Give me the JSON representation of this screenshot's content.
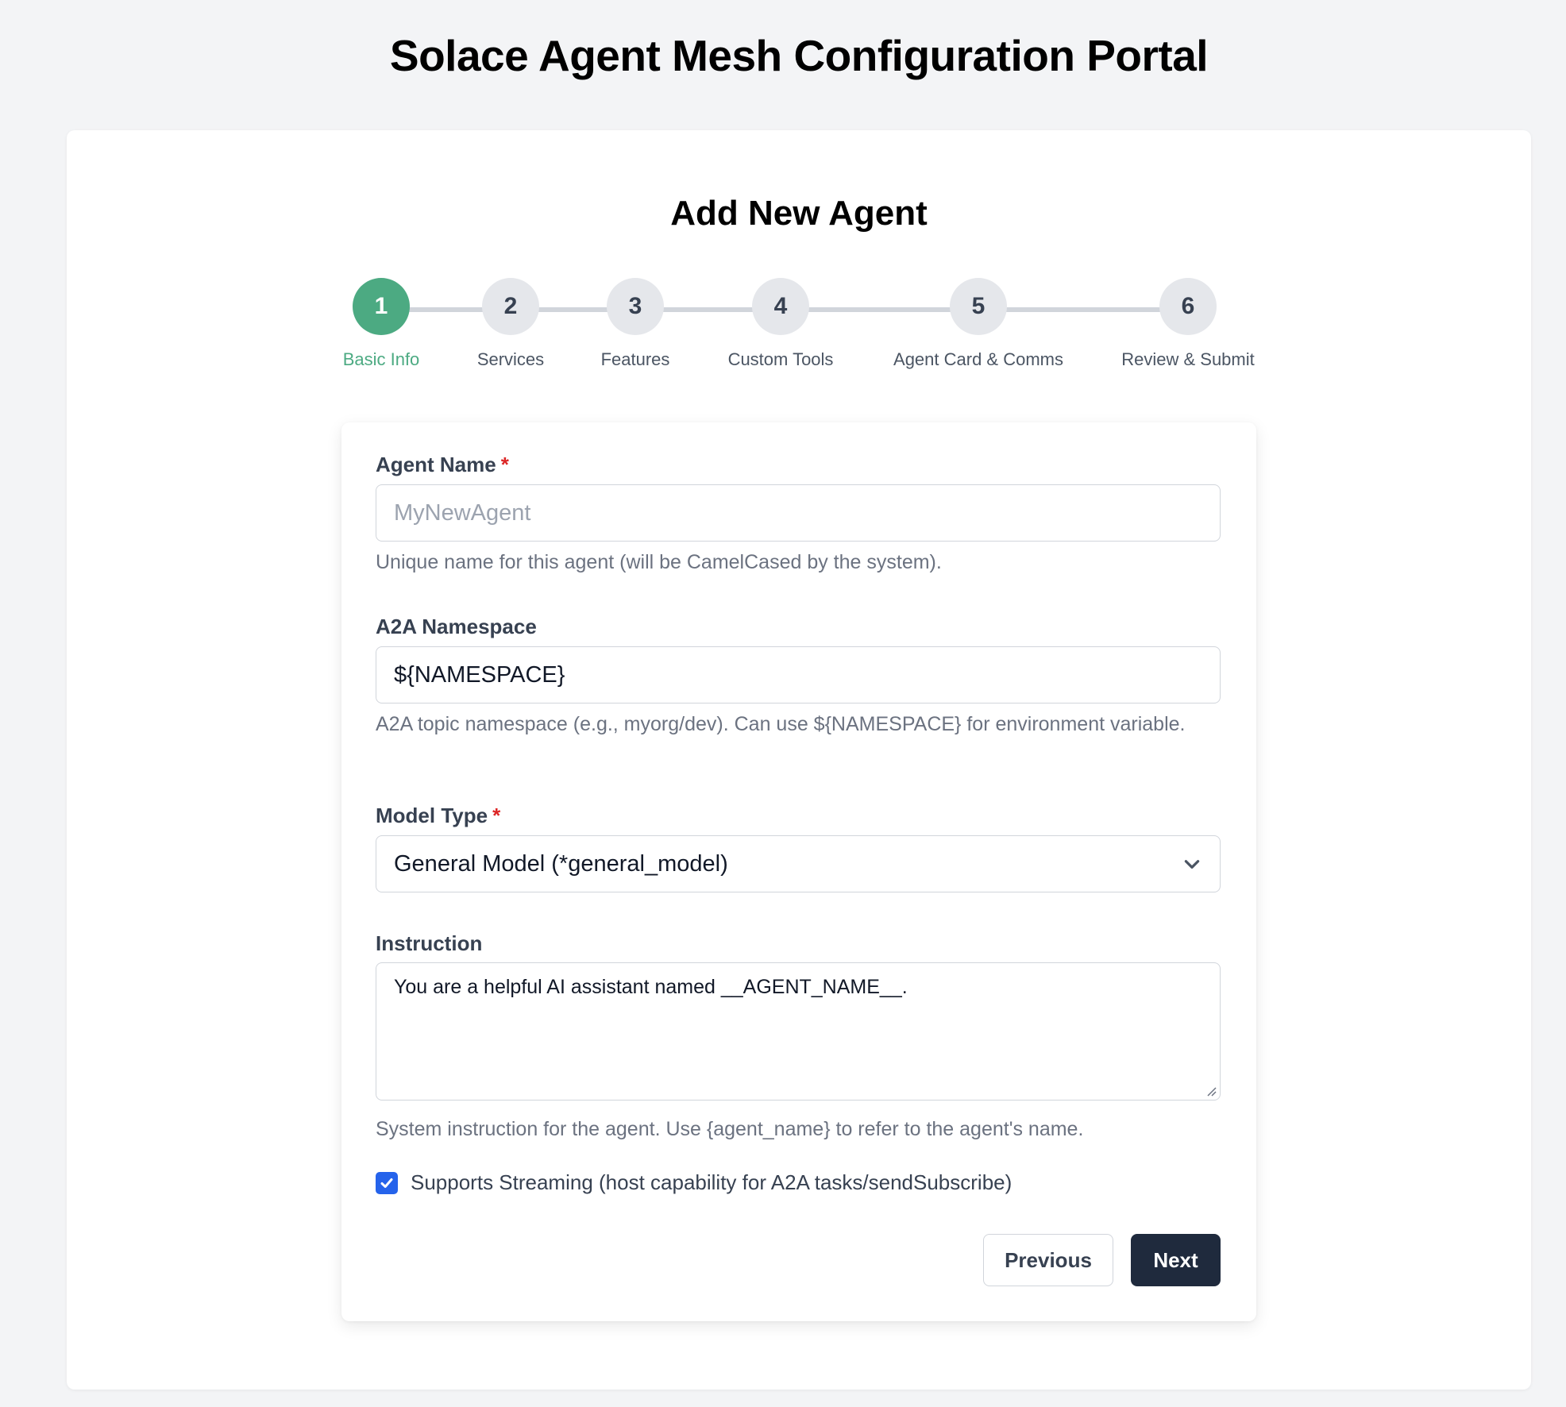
{
  "header": {
    "title": "Solace Agent Mesh Configuration Portal"
  },
  "card": {
    "title": "Add New Agent"
  },
  "steps": [
    {
      "number": "1",
      "label": "Basic Info",
      "active": true
    },
    {
      "number": "2",
      "label": "Services",
      "active": false
    },
    {
      "number": "3",
      "label": "Features",
      "active": false
    },
    {
      "number": "4",
      "label": "Custom Tools",
      "active": false
    },
    {
      "number": "5",
      "label": "Agent Card & Comms",
      "active": false
    },
    {
      "number": "6",
      "label": "Review & Submit",
      "active": false
    }
  ],
  "form": {
    "agent_name": {
      "label": "Agent Name",
      "required_mark": "*",
      "value": "",
      "placeholder": "MyNewAgent",
      "help": "Unique name for this agent (will be CamelCased by the system)."
    },
    "namespace": {
      "label": "A2A Namespace",
      "value": "${NAMESPACE}",
      "help": "A2A topic namespace (e.g., myorg/dev). Can use ${NAMESPACE} for environment variable."
    },
    "model_type": {
      "label": "Model Type",
      "required_mark": "*",
      "selected": "General Model (*general_model)"
    },
    "instruction": {
      "label": "Instruction",
      "value": "You are a helpful AI assistant named __AGENT_NAME__.",
      "help": "System instruction for the agent. Use {agent_name} to refer to the agent's name."
    },
    "streaming": {
      "label": "Supports Streaming (host capability for A2A tasks/sendSubscribe)",
      "checked": true
    }
  },
  "buttons": {
    "previous": "Previous",
    "next": "Next"
  },
  "colors": {
    "accent": "#4caa82",
    "primary_button": "#1f2a3d",
    "checkbox": "#2563eb",
    "required": "#dc2626"
  }
}
